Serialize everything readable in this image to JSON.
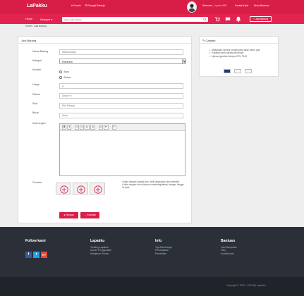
{
  "brand": "LaPakku",
  "top_links": {
    "favorit": "♥ Favorit",
    "riwayat": "☰ Riwayat Belanja"
  },
  "user": {
    "welcome": "Welcome,",
    "username": "Lapakku889",
    "kontak": "Kontak Kami",
    "bantuan": "Buka Bantuan"
  },
  "nav": {
    "home": "Home",
    "kategori": "Kategori ▾",
    "jual": "+ Jual Barang"
  },
  "search": {
    "placeholder": "Saya ingin belanja ..."
  },
  "breadcrumb": "Home / Jual Barang",
  "form": {
    "title": "Jual Barang",
    "labels": {
      "nama": "Nama Barang",
      "kategori": "Kategori",
      "kondisi": "Kondisi",
      "harga": "Harga",
      "diskon": "Diskon",
      "stok": "Stok",
      "berat": "Berat",
      "keterangan": "Keterangan",
      "gambar": "Gambar"
    },
    "placeholders": {
      "nama": "Nama barang",
      "diskon": "Diskon %",
      "stok": "Stok Barang",
      "berat": "Gram"
    },
    "values": {
      "kategori": "Elektronik",
      "harga": "0"
    },
    "kondisi_options": [
      "Baru",
      "Bekas"
    ],
    "toolbar": [
      "B",
      "I",
      "≡",
      "≡",
      "⇤",
      "⇥",
      "∞",
      "↶",
      "?"
    ],
    "gambar_note": [
      "• Main dengan banyak foto, lebih dianjurkan oleh pembeli.",
      "• Main dengan foto minimum menimingkatkan, dengan hingga 3x lipat."
    ],
    "simpan": "● Simpan",
    "kembali": "← Kembali"
  },
  "catatan": {
    "title": "Catatan",
    "items": [
      "Masukkan semua produk yang akan kamu jual",
      "Pastikan stok barang tercukupi",
      "Upload gambar berupa JPG, PNG"
    ]
  },
  "footer": {
    "follow": "Follow kami",
    "lapakku": {
      "title": "Lapakku",
      "links": [
        "Tentang Lapakku",
        "Aturan Penggunaan",
        "Kebijakan Privasi"
      ]
    },
    "info": {
      "title": "Info",
      "links": [
        "Tips Berbelanja",
        "Pembayaran",
        "Pembelian"
      ]
    },
    "bantuan": {
      "title": "Bantuan",
      "links": [
        "Cara Berjualan",
        "FAQ",
        "Kontak kami"
      ]
    },
    "copyright": "Copyright © 2015 - 2016 By Lapakku"
  },
  "colors": {
    "primary": "#d81e47",
    "footer": "#2b3038"
  }
}
